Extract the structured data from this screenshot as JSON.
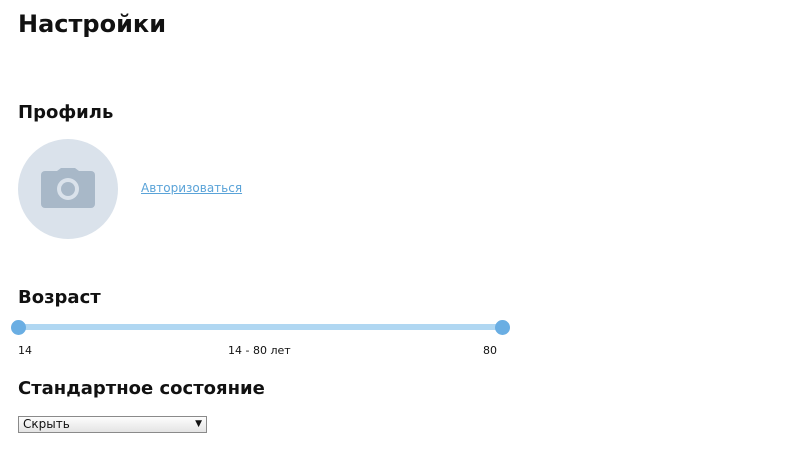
{
  "page": {
    "title": "Настройки"
  },
  "profile": {
    "section_title": "Профиль",
    "avatar_icon": "camera-icon",
    "login_link": "Авторизоваться",
    "colors": {
      "avatar_bg": "#dae2eb",
      "camera": "#a8b8c8",
      "link": "#5aa3d8"
    }
  },
  "age": {
    "section_title": "Возраст",
    "min": 14,
    "max": 80,
    "range_label": "14 - 80 лет",
    "min_label": "14",
    "max_label": "80",
    "selected_from": 14,
    "selected_to": 80,
    "colors": {
      "track": "#b0d7f2",
      "handle": "#6aaee3"
    }
  },
  "default_state": {
    "section_title": "Стандартное состояние",
    "selected": "Скрыть",
    "arrow_icon": "dropdown-arrow-icon"
  }
}
